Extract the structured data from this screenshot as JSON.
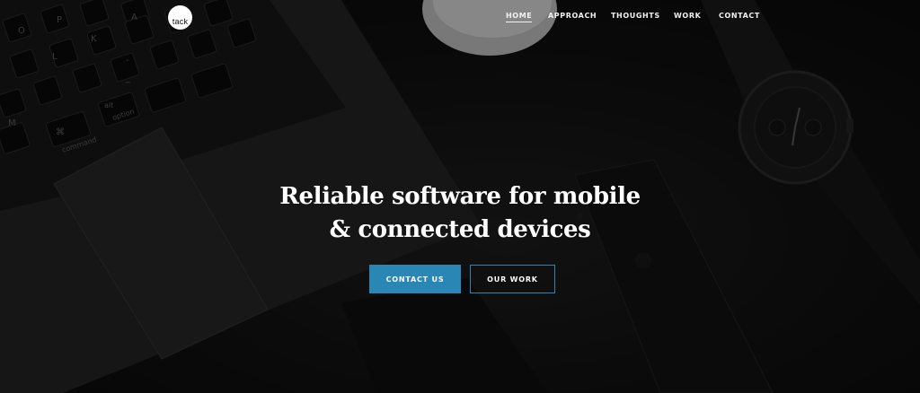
{
  "brand": {
    "logo_text": "tack"
  },
  "nav": {
    "items": [
      {
        "label": "HOME",
        "active": true
      },
      {
        "label": "APPROACH",
        "active": false
      },
      {
        "label": "THOUGHTS",
        "active": false
      },
      {
        "label": "WORK",
        "active": false
      },
      {
        "label": "CONTACT",
        "active": false
      }
    ]
  },
  "hero": {
    "headline_line1": "Reliable software for mobile",
    "headline_line2": "& connected devices",
    "cta_primary": "CONTACT US",
    "cta_secondary": "OUR WORK"
  },
  "background": {
    "keyboard_keys": [
      "O",
      "P",
      "A",
      "K",
      "L",
      "M",
      "⌘",
      "command",
      "alt",
      "option",
      "-",
      "_"
    ]
  },
  "colors": {
    "accent": "#2a86b5",
    "background": "#0c0c0c",
    "text": "#ffffff"
  }
}
